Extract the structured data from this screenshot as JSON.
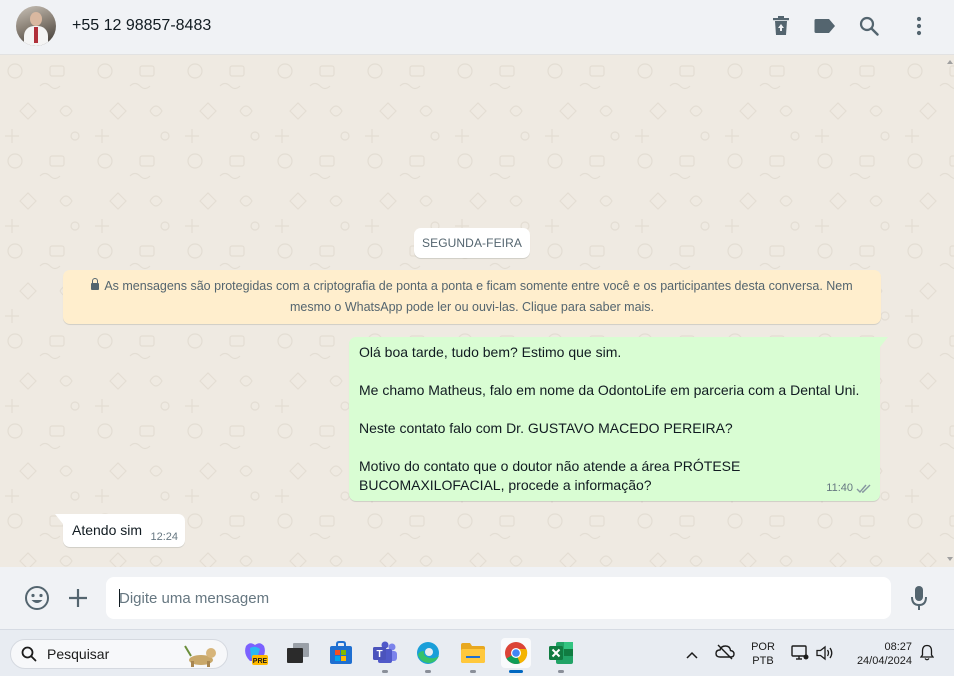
{
  "header": {
    "contact_name": "+55 12 98857-8483",
    "icons": [
      "trash-icon",
      "label-icon",
      "search-icon",
      "menu-dots-icon"
    ]
  },
  "chat": {
    "day_label": "SEGUNDA-FEIRA",
    "encryption_notice": "As mensagens são protegidas com a criptografia de ponta a ponta e ficam somente entre você e os participantes desta conversa. Nem mesmo o WhatsApp pode ler ou ouvi-las. Clique para saber mais.",
    "messages": [
      {
        "direction": "out",
        "text": "Olá boa tarde, tudo bem? Estimo que sim.\n\nMe chamo Matheus, falo em nome da OdontoLife em parceria com a Dental Uni.\n\nNeste contato falo com Dr. GUSTAVO MACEDO PEREIRA?\n\nMotivo do contato que o doutor não atende a área PRÓTESE BUCOMAXILOFACIAL, procede a informação?",
        "time": "11:40",
        "status": "read"
      },
      {
        "direction": "in",
        "text": "Atendo sim",
        "time": "12:24"
      }
    ]
  },
  "composer": {
    "placeholder": "Digite uma mensagem",
    "value": ""
  },
  "taskbar": {
    "search_placeholder": "Pesquisar",
    "apps": [
      "copilot-pre",
      "task-view",
      "microsoft-store",
      "teams",
      "edge",
      "file-explorer",
      "chrome",
      "excel"
    ],
    "copilot_badge": "PRE",
    "language_line1": "POR",
    "language_line2": "PTB",
    "time": "08:27",
    "date": "24/04/2024"
  },
  "colors": {
    "outgoing_bubble": "#d9fdd3",
    "incoming_bubble": "#ffffff",
    "notice_bg": "#ffeecd",
    "chat_bg": "#efeae2",
    "panel_bg": "#f0f2f5",
    "read_ticks": "#53bdeb"
  }
}
